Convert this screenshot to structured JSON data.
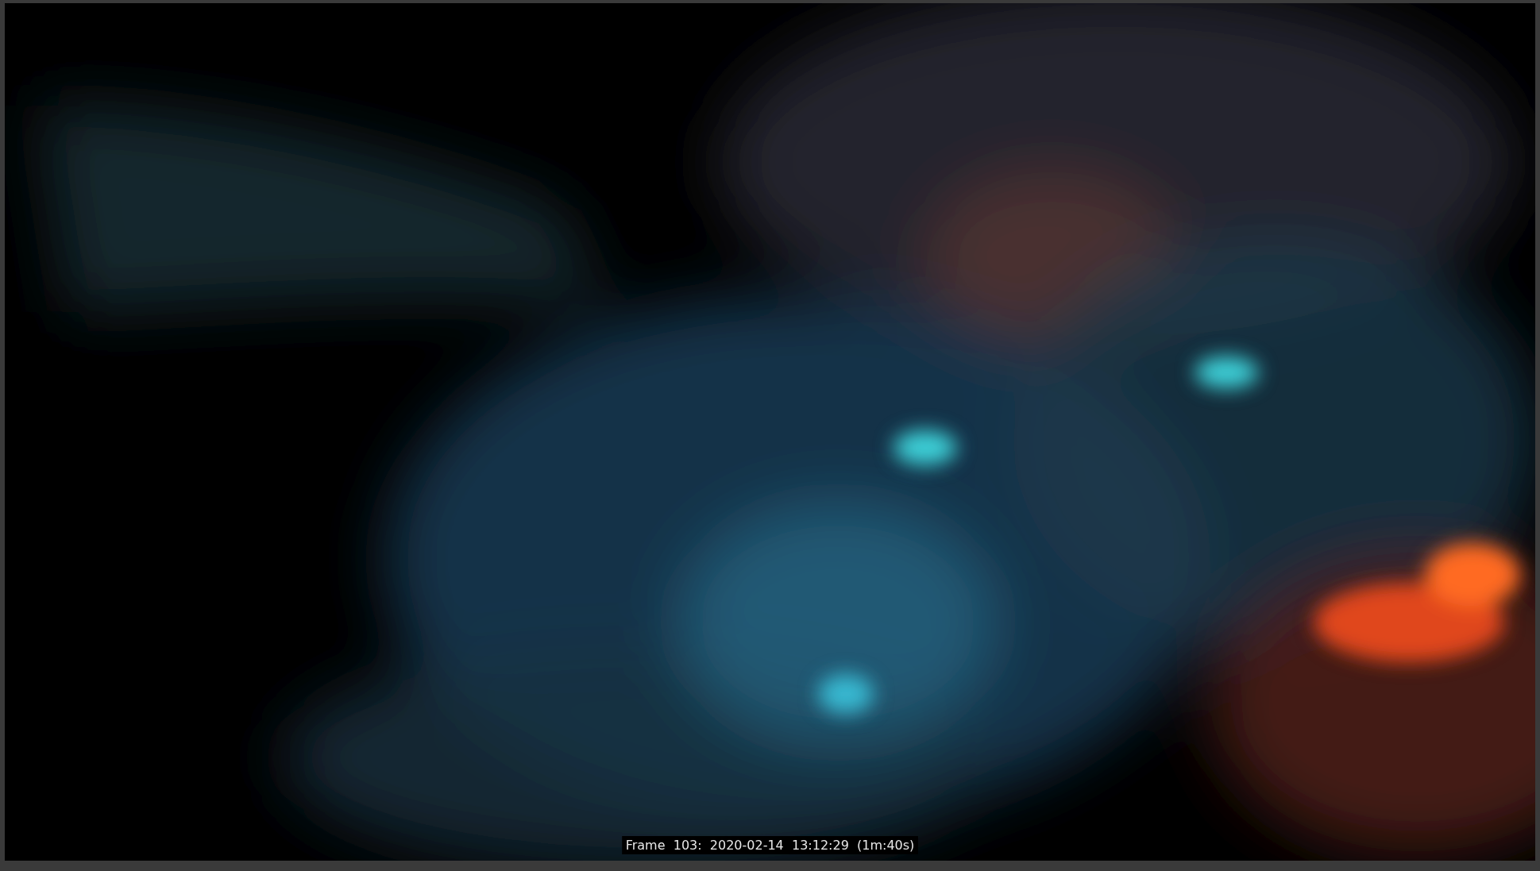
{
  "viewport": {
    "kind": "picture",
    "caption": "Frame  103:  2020-02-14  13:12:29  (1m:40s)"
  }
}
